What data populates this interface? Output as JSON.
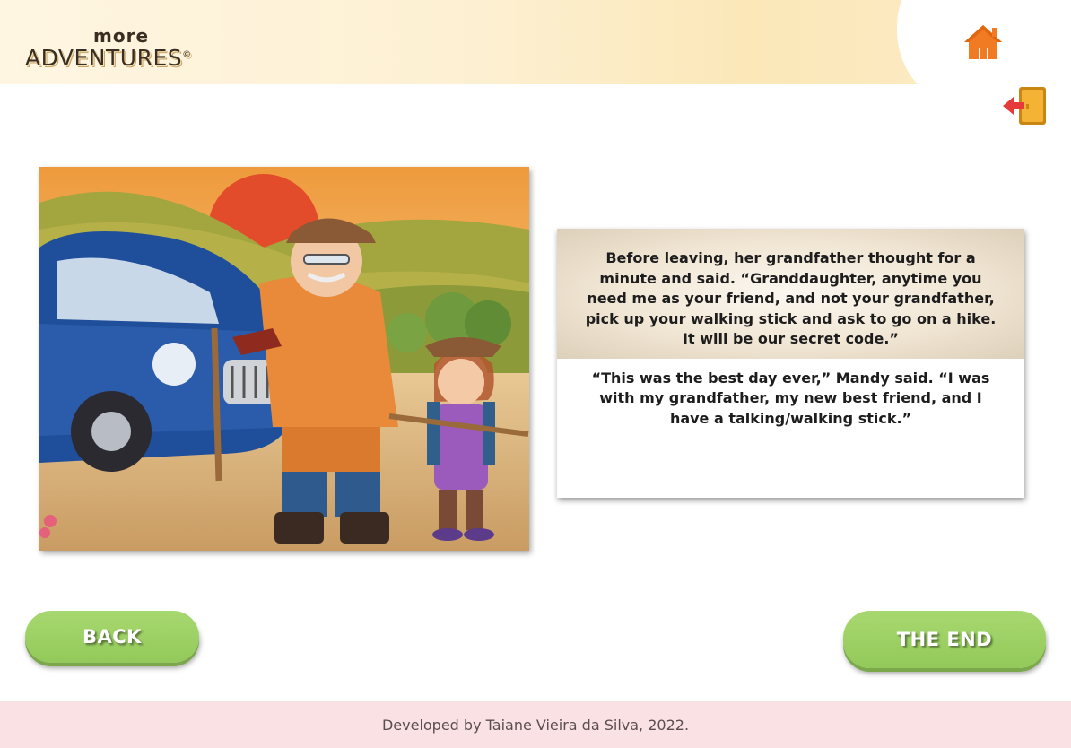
{
  "header": {
    "logo_top": "more",
    "logo_main": "ADVENTURES",
    "logo_mark": "©",
    "home_icon": "home-icon",
    "exit_icon": "exit-door-icon"
  },
  "story": {
    "paragraphs": [
      "Before leaving, her grandfather thought for a minute and said. “Granddaughter, anytime you need me as your friend, and not your grandfather, pick up your walking stick and ask to go on a hike. It will be our secret code.”",
      "“This was the best day ever,” Mandy said. “I was with my grandfather, my new best friend, and I have a talking/walking stick.”"
    ]
  },
  "nav": {
    "back_label": "BACK",
    "end_label": "THE END"
  },
  "footer": {
    "credit": "Developed by Taiane Vieira da Silva, 2022."
  },
  "colors": {
    "button_green": "#9bd064",
    "home_orange": "#f07b22",
    "footer_pink": "#fae1e4"
  }
}
